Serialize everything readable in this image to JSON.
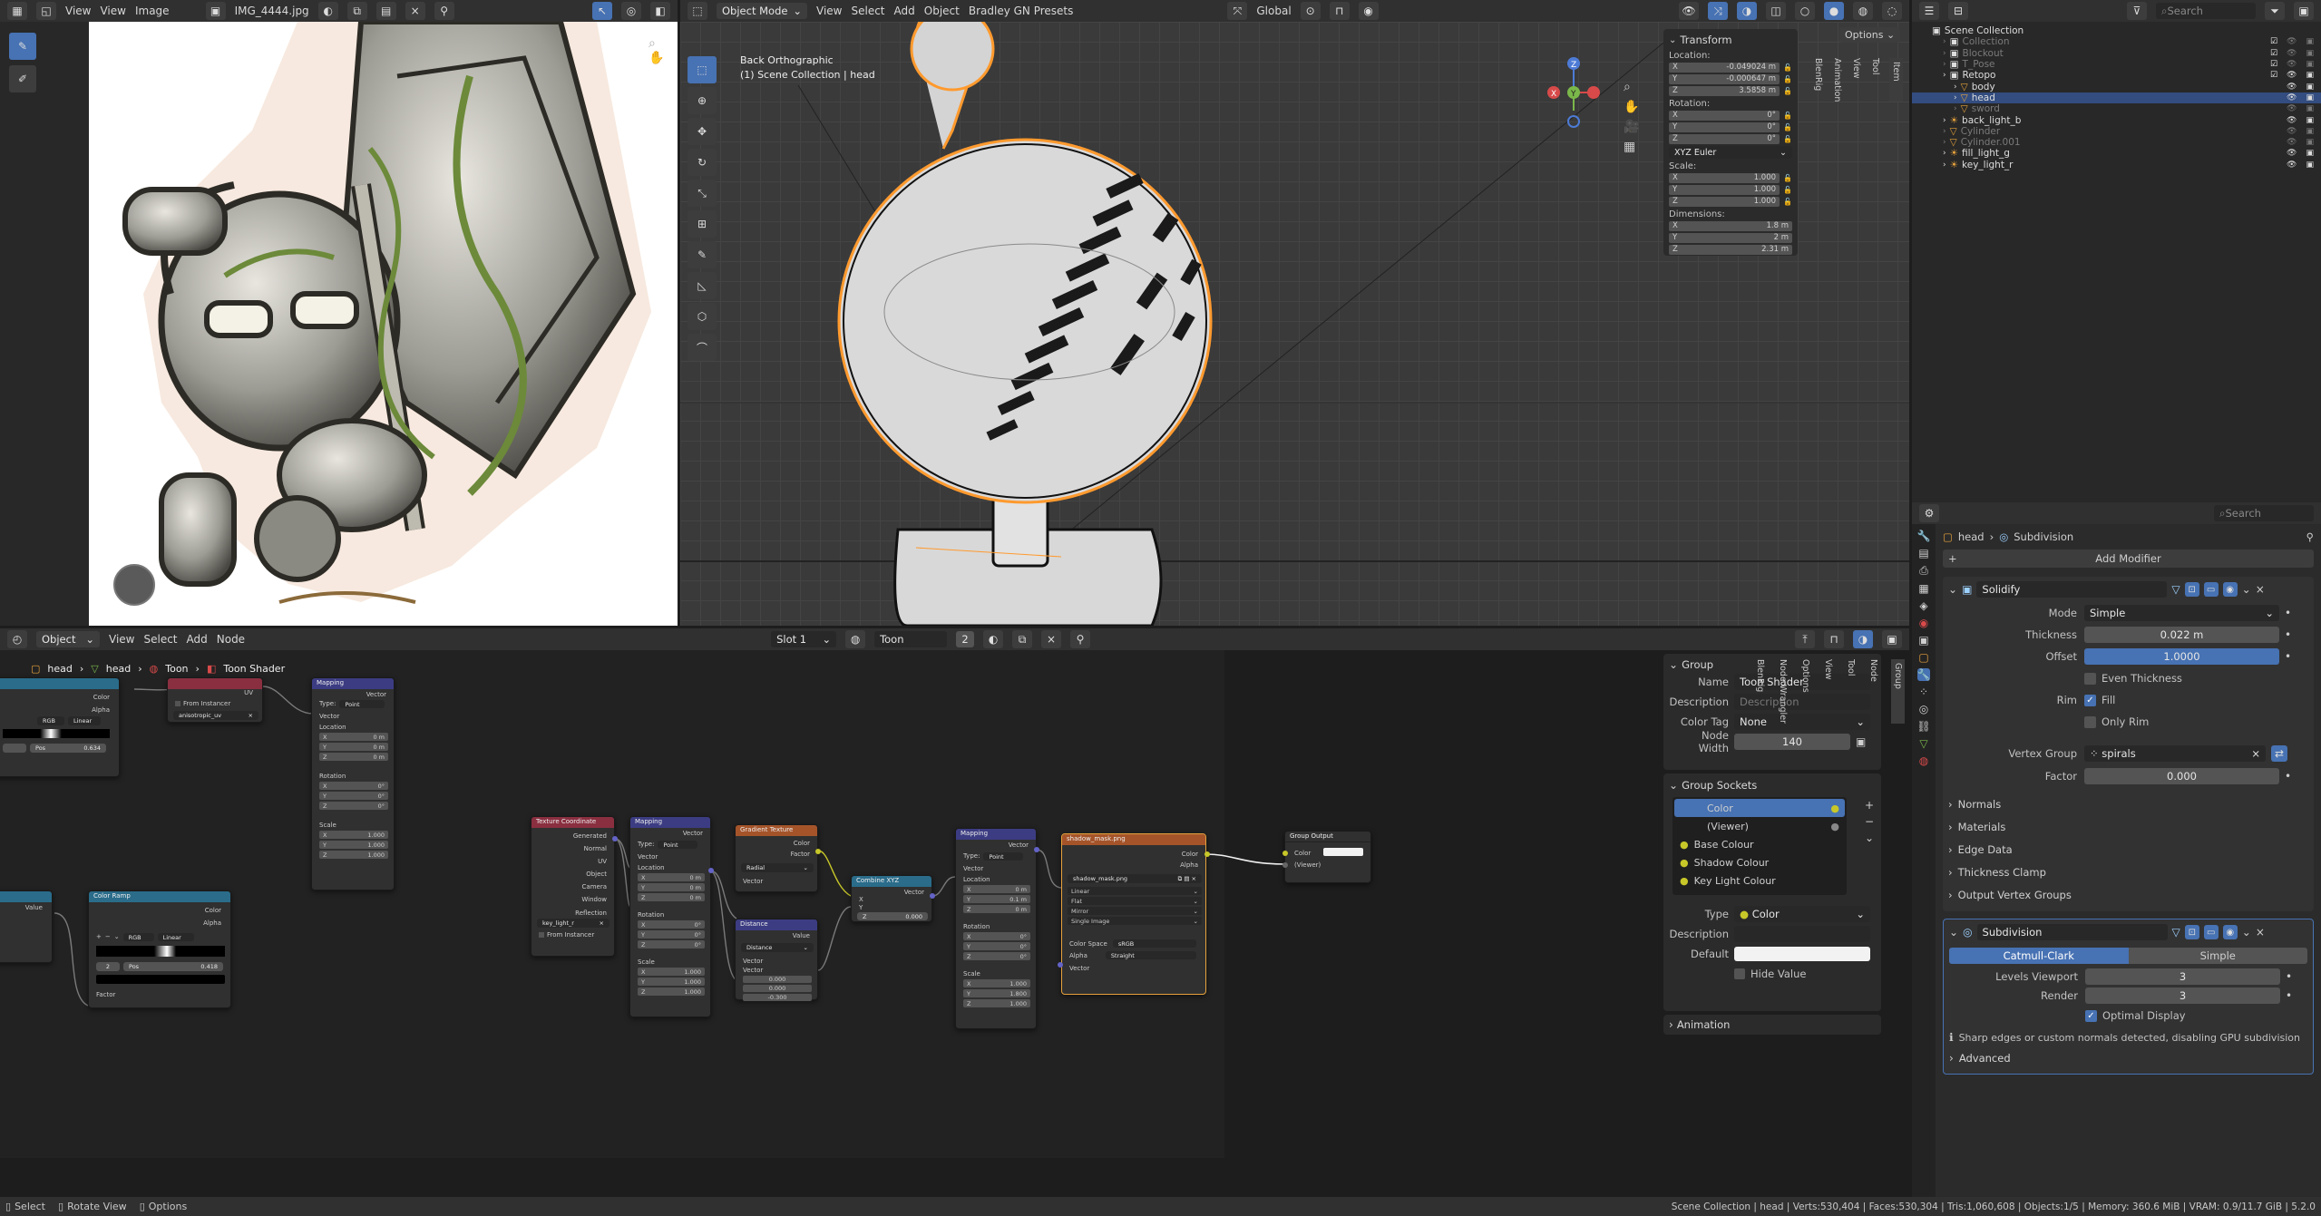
{
  "image_editor": {
    "menu": [
      "View",
      "View",
      "Image"
    ],
    "image_name": "IMG_4444.jpg"
  },
  "viewport": {
    "mode": "Object Mode",
    "menu": [
      "View",
      "Select",
      "Add",
      "Object",
      "Bradley GN Presets"
    ],
    "orientation": "Global",
    "view_name": "Back Orthographic",
    "view_sub": "(1) Scene Collection | head",
    "options_label": "Options",
    "side_tabs": [
      "Item",
      "Tool",
      "View",
      "Animation",
      "BlenRig"
    ]
  },
  "transform": {
    "title": "Transform",
    "location_label": "Location:",
    "location": [
      {
        "axis": "X",
        "value": "-0.049024 m"
      },
      {
        "axis": "Y",
        "value": "-0.000647 m"
      },
      {
        "axis": "Z",
        "value": "3.5858 m"
      }
    ],
    "rotation_label": "Rotation:",
    "rotation": [
      {
        "axis": "X",
        "value": "0°"
      },
      {
        "axis": "Y",
        "value": "0°"
      },
      {
        "axis": "Z",
        "value": "0°"
      }
    ],
    "rotation_mode": "XYZ Euler",
    "scale_label": "Scale:",
    "scale": [
      {
        "axis": "X",
        "value": "1.000"
      },
      {
        "axis": "Y",
        "value": "1.000"
      },
      {
        "axis": "Z",
        "value": "1.000"
      }
    ],
    "dimensions_label": "Dimensions:",
    "dimensions": [
      {
        "axis": "X",
        "value": "1.8 m"
      },
      {
        "axis": "Y",
        "value": "2 m"
      },
      {
        "axis": "Z",
        "value": "2.31 m"
      }
    ]
  },
  "outliner": {
    "search_placeholder": "Search",
    "root": "Scene Collection",
    "items": [
      {
        "name": "Collection",
        "depth": 1,
        "dim": true
      },
      {
        "name": "Blockout",
        "depth": 1,
        "dim": true
      },
      {
        "name": "T_Pose",
        "depth": 1,
        "dim": true
      },
      {
        "name": "Retopo",
        "depth": 1,
        "dim": false
      },
      {
        "name": "body",
        "depth": 2,
        "dim": false
      },
      {
        "name": "head",
        "depth": 2,
        "dim": false,
        "selected": true
      },
      {
        "name": "sword",
        "depth": 2,
        "dim": true
      },
      {
        "name": "back_light_b",
        "depth": 1,
        "dim": false
      },
      {
        "name": "Cylinder",
        "depth": 1,
        "dim": true
      },
      {
        "name": "Cylinder.001",
        "depth": 1,
        "dim": true
      },
      {
        "name": "fill_light_g",
        "depth": 1,
        "dim": false
      },
      {
        "name": "key_light_r",
        "depth": 1,
        "dim": false
      }
    ]
  },
  "properties": {
    "search_placeholder": "Search",
    "breadcrumb_object": "head",
    "breadcrumb_modifier": "Subdivision",
    "add_modifier": "Add Modifier",
    "solidify": {
      "name": "Solidify",
      "mode_label": "Mode",
      "mode": "Simple",
      "thickness_label": "Thickness",
      "thickness": "0.022 m",
      "offset_label": "Offset",
      "offset": "1.0000",
      "even_thickness": "Even Thickness",
      "rim_label": "Rim",
      "fill": "Fill",
      "only_rim": "Only Rim",
      "vgroup_label": "Vertex Group",
      "vgroup": "spirals",
      "factor_label": "Factor",
      "factor": "0.000",
      "subpanels": [
        "Normals",
        "Materials",
        "Edge Data",
        "Thickness Clamp",
        "Output Vertex Groups"
      ]
    },
    "subdivision": {
      "name": "Subdivision",
      "type_a": "Catmull-Clark",
      "type_b": "Simple",
      "levels_label": "Levels Viewport",
      "levels": "3",
      "render_label": "Render",
      "render": "3",
      "optimal": "Optimal Display",
      "warning": "Sharp edges or custom normals detected, disabling GPU subdivision",
      "advanced": "Advanced"
    }
  },
  "node_editor": {
    "editor_type": "Object",
    "menu": [
      "View",
      "Select",
      "Add",
      "Node"
    ],
    "slot": "Slot 1",
    "material": "Toon",
    "users": "2",
    "breadcrumbs": [
      "head",
      "head",
      "Toon",
      "Toon Shader"
    ],
    "side_tabs": [
      "Group",
      "Node",
      "Tool",
      "View",
      "Options",
      "Node Wrangler",
      "BlenRig"
    ]
  },
  "group_panel": {
    "title": "Group",
    "name_label": "Name",
    "name": "Toon Shader",
    "desc_label": "Description",
    "desc_placeholder": "Description",
    "color_tag_label": "Color Tag",
    "color_tag": "None",
    "width_label": "Node Width",
    "width": "140",
    "sockets_title": "Group Sockets",
    "sockets": [
      "Color",
      "(Viewer)",
      "Base Colour",
      "Shadow Colour",
      "Key Light Colour"
    ],
    "type_label": "Type",
    "type": "Color",
    "description_label": "Description",
    "default_label": "Default",
    "hide_value": "Hide Value",
    "animation": "Animation"
  },
  "nodes": {
    "tex_coord": {
      "title": "Texture Coordinate",
      "outputs": [
        "Generated",
        "Normal",
        "UV",
        "Object",
        "Camera",
        "Window",
        "Reflection"
      ],
      "obj": "key_light_r",
      "from_instancer": "From Instancer"
    },
    "mapping1": {
      "title": "Mapping",
      "out": "Vector",
      "type_label": "Type:",
      "type": "Point",
      "vector": "Vector",
      "location": "Location",
      "loc": [
        "0 m",
        "0 m",
        "0 m"
      ],
      "rotation": "Rotation",
      "rot": [
        "0°",
        "0°",
        "0°"
      ],
      "scale": "Scale",
      "scl": [
        "1.000",
        "1.000",
        "1.000"
      ]
    },
    "gradient": {
      "title": "Gradient Texture",
      "outs": [
        "Color",
        "Factor"
      ],
      "mode": "Radial",
      "vector": "Vector"
    },
    "distance": {
      "title": "Distance",
      "out": "Value",
      "mode": "Distance",
      "vector": "Vector",
      "vals": [
        "0.000",
        "0.000",
        "-0.300"
      ]
    },
    "combine": {
      "title": "Combine XYZ",
      "out": "Vector",
      "x": "X",
      "y": "Y",
      "z": "Z",
      "zval": "0.000"
    },
    "mapping2": {
      "title": "Mapping",
      "out": "Vector",
      "type": "Point",
      "loc": [
        "0 m",
        "0.1 m",
        "0 m"
      ],
      "rot": [
        "0°",
        "0°",
        "0°"
      ],
      "scl": [
        "1.000",
        "1.800",
        "1.000"
      ]
    },
    "image": {
      "title": "shadow_mask.png",
      "outs": [
        "Color",
        "Alpha"
      ],
      "file": "shadow_mask.png",
      "opts": [
        "Linear",
        "Flat",
        "Mirror",
        "Single Image"
      ],
      "cs_label": "Color Space",
      "cs": "sRGB",
      "alpha_label": "Alpha",
      "alpha": "Straight",
      "vector": "Vector"
    },
    "group_out": {
      "title": "Group Output",
      "ins": [
        "Color",
        "(Viewer)"
      ]
    },
    "ramp_left": {
      "title": "Color Ramp",
      "outs": [
        "Color",
        "Alpha"
      ],
      "mode": "RGB",
      "interp": "Linear",
      "idx": "2",
      "pos_label": "Pos",
      "pos": "0.418",
      "fac": "Factor",
      "value": "Value"
    },
    "ramp_top": {
      "outs": [
        "Color",
        "Alpha"
      ],
      "mode": "RGB",
      "interp": "Linear",
      "pos_label": "Pos",
      "pos": "0.634"
    },
    "attr_node": {
      "uv": "UV",
      "from_instancer": "From Instancer",
      "name": "anisotropic_uv"
    },
    "mapping_top": {
      "title": "Mapping",
      "out": "Vector",
      "type_label": "Type:",
      "type": "Point",
      "vector": "Vector",
      "location": "Location",
      "loc": [
        "0 m",
        "0 m",
        "0 m"
      ],
      "rotation": "Rotation",
      "rot": [
        "0°",
        "0°",
        "0°"
      ],
      "scale": "Scale",
      "scl": [
        "1.000",
        "1.000",
        "1.000"
      ]
    }
  },
  "statusbar": {
    "left": [
      "Select",
      "Rotate View",
      "Options"
    ],
    "right": "Scene Collection | head | Verts:530,404 | Faces:530,304 | Tris:1,060,608 | Objects:1/5 | Memory: 360.6 MiB | VRAM: 0.9/11.7 GiB | 5.2.0"
  },
  "colors": {
    "accent": "#4772b3",
    "selection": "#ff9a2e",
    "node_bg": "#303030",
    "shader_header": "#6a4f9e",
    "texture_header": "#a5542a",
    "vector_header": "#3c3c83",
    "converter_header": "#2a6c8a",
    "input_header": "#8a2f40"
  }
}
